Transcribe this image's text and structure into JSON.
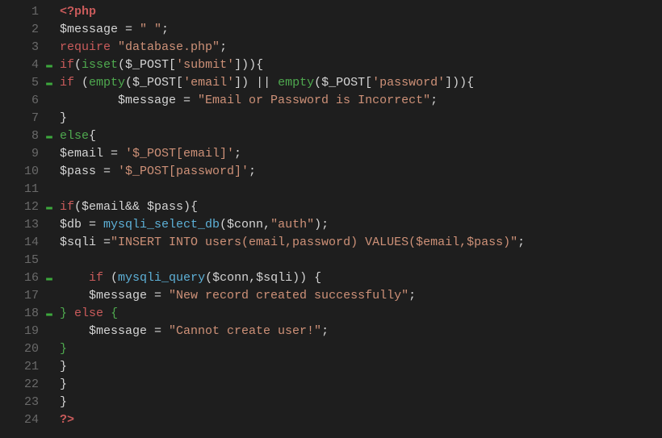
{
  "lines": [
    {
      "num": "1",
      "fold": "",
      "tokens": [
        {
          "t": "<?php",
          "c": "phptag"
        }
      ]
    },
    {
      "num": "2",
      "fold": "",
      "tokens": [
        {
          "t": "$message",
          "c": "var"
        },
        {
          "t": " = ",
          "c": "punc"
        },
        {
          "t": "\" \"",
          "c": "str"
        },
        {
          "t": ";",
          "c": "punc"
        }
      ]
    },
    {
      "num": "3",
      "fold": "",
      "tokens": [
        {
          "t": "require",
          "c": "kw"
        },
        {
          "t": " ",
          "c": "punc"
        },
        {
          "t": "\"database.php\"",
          "c": "str"
        },
        {
          "t": ";",
          "c": "punc"
        }
      ]
    },
    {
      "num": "4",
      "fold": "▬",
      "tokens": [
        {
          "t": "if",
          "c": "kw"
        },
        {
          "t": "(",
          "c": "punc"
        },
        {
          "t": "isset",
          "c": "kw2"
        },
        {
          "t": "($_POST[",
          "c": "punc"
        },
        {
          "t": "'submit'",
          "c": "str"
        },
        {
          "t": "])){",
          "c": "punc"
        }
      ]
    },
    {
      "num": "5",
      "fold": "▬",
      "tokens": [
        {
          "t": "if",
          "c": "kw"
        },
        {
          "t": " (",
          "c": "punc"
        },
        {
          "t": "empty",
          "c": "kw2"
        },
        {
          "t": "($_POST[",
          "c": "punc"
        },
        {
          "t": "'email'",
          "c": "str"
        },
        {
          "t": "]) || ",
          "c": "punc"
        },
        {
          "t": "empty",
          "c": "kw2"
        },
        {
          "t": "($_POST[",
          "c": "punc"
        },
        {
          "t": "'password'",
          "c": "str"
        },
        {
          "t": "])){",
          "c": "punc"
        }
      ]
    },
    {
      "num": "6",
      "fold": "",
      "tokens": [
        {
          "t": "        $message = ",
          "c": "var"
        },
        {
          "t": "\"Email or Password is Incorrect\"",
          "c": "str"
        },
        {
          "t": ";",
          "c": "punc"
        }
      ]
    },
    {
      "num": "7",
      "fold": "",
      "tokens": [
        {
          "t": "}",
          "c": "punc"
        }
      ]
    },
    {
      "num": "8",
      "fold": "▬",
      "tokens": [
        {
          "t": "else",
          "c": "kw2"
        },
        {
          "t": "{",
          "c": "punc"
        }
      ]
    },
    {
      "num": "9",
      "fold": "",
      "tokens": [
        {
          "t": "$email = ",
          "c": "var"
        },
        {
          "t": "'$_POST[email]'",
          "c": "str"
        },
        {
          "t": ";",
          "c": "punc"
        }
      ]
    },
    {
      "num": "10",
      "fold": "",
      "tokens": [
        {
          "t": "$pass = ",
          "c": "var"
        },
        {
          "t": "'$_POST[password]'",
          "c": "str"
        },
        {
          "t": ";",
          "c": "punc"
        }
      ]
    },
    {
      "num": "11",
      "fold": "",
      "tokens": []
    },
    {
      "num": "12",
      "fold": "▬",
      "tokens": [
        {
          "t": "if",
          "c": "kw"
        },
        {
          "t": "($email&& $pass){",
          "c": "punc"
        }
      ]
    },
    {
      "num": "13",
      "fold": "",
      "tokens": [
        {
          "t": "$db = ",
          "c": "var"
        },
        {
          "t": "mysqli_select_db",
          "c": "func"
        },
        {
          "t": "($conn,",
          "c": "punc"
        },
        {
          "t": "\"auth\"",
          "c": "str"
        },
        {
          "t": ");",
          "c": "punc"
        }
      ]
    },
    {
      "num": "14",
      "fold": "",
      "tokens": [
        {
          "t": "$sqli =",
          "c": "var"
        },
        {
          "t": "\"INSERT INTO users(email,password) VALUES($email,$pass)\"",
          "c": "str"
        },
        {
          "t": ";",
          "c": "punc"
        }
      ]
    },
    {
      "num": "15",
      "fold": "",
      "tokens": []
    },
    {
      "num": "16",
      "fold": "▬",
      "tokens": [
        {
          "t": "    ",
          "c": "punc"
        },
        {
          "t": "if",
          "c": "kw"
        },
        {
          "t": " (",
          "c": "punc"
        },
        {
          "t": "mysqli_query",
          "c": "func"
        },
        {
          "t": "($conn,$sqli)) {",
          "c": "punc"
        }
      ]
    },
    {
      "num": "17",
      "fold": "",
      "tokens": [
        {
          "t": "    $message = ",
          "c": "var"
        },
        {
          "t": "\"New record created successfully\"",
          "c": "str"
        },
        {
          "t": ";",
          "c": "punc"
        }
      ]
    },
    {
      "num": "18",
      "fold": "▬",
      "tokens": [
        {
          "t": "}",
          "c": "brace"
        },
        {
          "t": " ",
          "c": "punc"
        },
        {
          "t": "else",
          "c": "kw"
        },
        {
          "t": " ",
          "c": "punc"
        },
        {
          "t": "{",
          "c": "brace"
        }
      ]
    },
    {
      "num": "19",
      "fold": "",
      "tokens": [
        {
          "t": "    $message = ",
          "c": "var"
        },
        {
          "t": "\"Cannot create user!\"",
          "c": "str"
        },
        {
          "t": ";",
          "c": "punc"
        }
      ]
    },
    {
      "num": "20",
      "fold": "",
      "tokens": [
        {
          "t": "}",
          "c": "brace"
        }
      ]
    },
    {
      "num": "21",
      "fold": "",
      "tokens": [
        {
          "t": "}",
          "c": "punc"
        }
      ]
    },
    {
      "num": "22",
      "fold": "",
      "tokens": [
        {
          "t": "}",
          "c": "punc"
        }
      ]
    },
    {
      "num": "23",
      "fold": "",
      "tokens": [
        {
          "t": "}",
          "c": "punc"
        }
      ]
    },
    {
      "num": "24",
      "fold": "",
      "tokens": [
        {
          "t": "?>",
          "c": "phptag"
        }
      ]
    }
  ]
}
